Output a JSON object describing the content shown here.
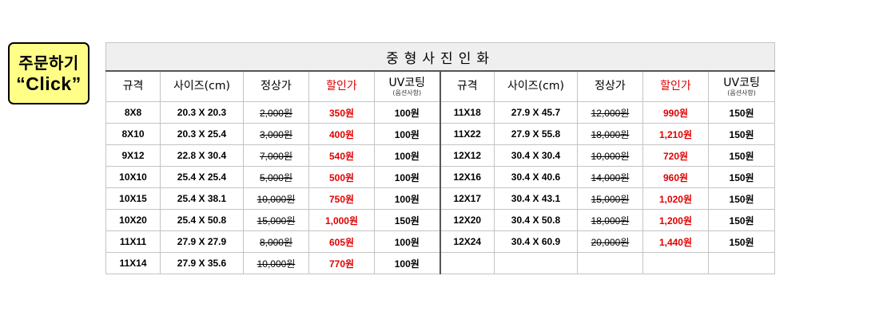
{
  "order_button": {
    "line1": "주문하기",
    "line2": "“Click”"
  },
  "table": {
    "title": "중형사진인화",
    "headers": {
      "size_spec": "규격",
      "size_cm": "사이즈(cm)",
      "regular_price": "정상가",
      "sale_price": "할인가",
      "uv_coating": "UV코팅",
      "uv_note": "(옵션사항)"
    },
    "left_rows": [
      {
        "spec": "8X8",
        "size": "20.3 X 20.3",
        "regular": "2,000원",
        "sale": "350원",
        "uv": "100원"
      },
      {
        "spec": "8X10",
        "size": "20.3 X 25.4",
        "regular": "3,000원",
        "sale": "400원",
        "uv": "100원"
      },
      {
        "spec": "9X12",
        "size": "22.8 X 30.4",
        "regular": "7,000원",
        "sale": "540원",
        "uv": "100원"
      },
      {
        "spec": "10X10",
        "size": "25.4 X 25.4",
        "regular": "5,000원",
        "sale": "500원",
        "uv": "100원"
      },
      {
        "spec": "10X15",
        "size": "25.4 X 38.1",
        "regular": "10,000원",
        "sale": "750원",
        "uv": "100원"
      },
      {
        "spec": "10X20",
        "size": "25.4 X 50.8",
        "regular": "15,000원",
        "sale": "1,000원",
        "uv": "150원"
      },
      {
        "spec": "11X11",
        "size": "27.9 X 27.9",
        "regular": "8,000원",
        "sale": "605원",
        "uv": "100원"
      },
      {
        "spec": "11X14",
        "size": "27.9 X 35.6",
        "regular": "10,000원",
        "sale": "770원",
        "uv": "100원"
      }
    ],
    "right_rows": [
      {
        "spec": "11X18",
        "size": "27.9 X 45.7",
        "regular": "12,000원",
        "sale": "990원",
        "uv": "150원"
      },
      {
        "spec": "11X22",
        "size": "27.9 X 55.8",
        "regular": "18,000원",
        "sale": "1,210원",
        "uv": "150원"
      },
      {
        "spec": "12X12",
        "size": "30.4 X 30.4",
        "regular": "10,000원",
        "sale": "720원",
        "uv": "150원"
      },
      {
        "spec": "12X16",
        "size": "30.4 X 40.6",
        "regular": "14,000원",
        "sale": "960원",
        "uv": "150원"
      },
      {
        "spec": "12X17",
        "size": "30.4 X 43.1",
        "regular": "15,000원",
        "sale": "1,020원",
        "uv": "150원"
      },
      {
        "spec": "12X20",
        "size": "30.4 X 50.8",
        "regular": "18,000원",
        "sale": "1,200원",
        "uv": "150원"
      },
      {
        "spec": "12X24",
        "size": "30.4 X 60.9",
        "regular": "20,000원",
        "sale": "1,440원",
        "uv": "150원"
      },
      {
        "spec": "",
        "size": "",
        "regular": "",
        "sale": "",
        "uv": ""
      }
    ]
  },
  "colors": {
    "sale_text": "#e00000",
    "button_bg": "#ffff88",
    "title_bg": "#efefef",
    "grid_border": "#c4c4c4"
  }
}
